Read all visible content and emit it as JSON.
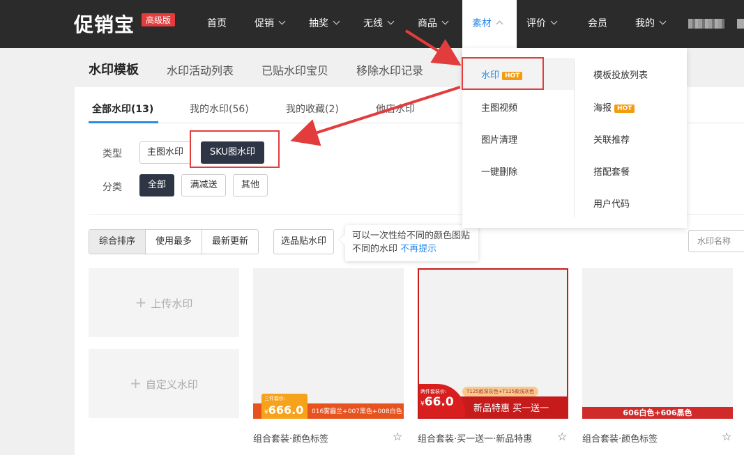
{
  "header": {
    "logo": "促销宝",
    "badge": "高级版",
    "nav": [
      {
        "label": "首页",
        "dropdown": false
      },
      {
        "label": "促销",
        "dropdown": true
      },
      {
        "label": "抽奖",
        "dropdown": true
      },
      {
        "label": "无线",
        "dropdown": true
      },
      {
        "label": "商品",
        "dropdown": true
      },
      {
        "label": "素材",
        "dropdown": true,
        "active": true
      },
      {
        "label": "评价",
        "dropdown": true
      },
      {
        "label": "会员",
        "dropdown": false
      },
      {
        "label": "我的",
        "dropdown": true
      }
    ]
  },
  "subheader": {
    "title": "水印模板",
    "links": [
      "水印活动列表",
      "已贴水印宝贝",
      "移除水印记录"
    ]
  },
  "tabs": [
    "全部水印(13)",
    "我的水印(56)",
    "我的收藏(2)",
    "他店水印"
  ],
  "filters": {
    "type_label": "类型",
    "type_options": [
      "主图水印",
      "SKU图水印"
    ],
    "category_label": "分类",
    "category_options": [
      "全部",
      "满减送",
      "其他"
    ]
  },
  "sort": {
    "options": [
      "综合排序",
      "使用最多",
      "最新更新"
    ],
    "pick_button": "选品贴水印",
    "tooltip_text": "可以一次性给不同的颜色图贴不同的水印",
    "tooltip_link": "不再提示",
    "search_placeholder": "水印名称"
  },
  "add_cards": [
    "上传水印",
    "自定义水印"
  ],
  "cards": [
    {
      "title": "组合套装·颜色标签",
      "badge_top": "三件套价:",
      "price_symbol": "¥",
      "price": "666.0",
      "banner": "016雾霾兰+007黑色+008白色"
    },
    {
      "title": "组合套装·买一送一·新品特惠",
      "badge_top": "两件套装价:",
      "price_symbol": "¥",
      "price": "66.0",
      "pill": "T125款深灰色+T125款浅灰色",
      "banner": "新品特惠 买一送一"
    },
    {
      "title": "组合套装·颜色标签",
      "banner": "606白色+606黑色"
    }
  ],
  "dropdown": {
    "left": [
      {
        "label": "水印",
        "hot": true
      },
      {
        "label": "主图视频"
      },
      {
        "label": "图片清理"
      },
      {
        "label": "一键删除"
      }
    ],
    "right": [
      {
        "label": "模板投放列表"
      },
      {
        "label": "海报",
        "hot": true
      },
      {
        "label": "关联推荐"
      },
      {
        "label": "搭配套餐"
      },
      {
        "label": "用户代码"
      }
    ],
    "hot_label": "HOT"
  },
  "colors": {
    "topbar": "#2b2b2b",
    "accent": "#2b8ae6",
    "dark_button": "#2e3545",
    "annotation_red": "#e23c3c",
    "hot_badge": "#f39c12"
  }
}
